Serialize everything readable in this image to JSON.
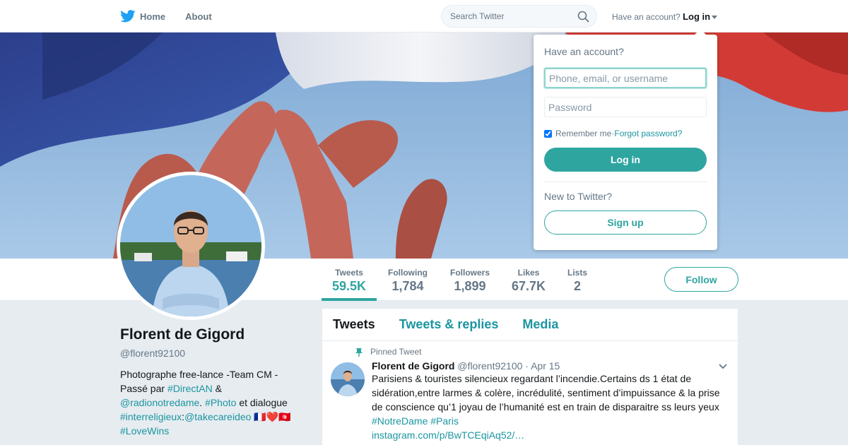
{
  "colors": {
    "accent": "#2fa5a0",
    "link": "#1b95a0",
    "twitter_blue": "#1da1f2"
  },
  "nav": {
    "home_label": "Home",
    "about_label": "About",
    "search_placeholder": "Search Twitter",
    "have_account": "Have an account?",
    "login_label": "Log in"
  },
  "profile": {
    "name": "Florent de Gigord",
    "screen_name": "@florent92100",
    "bio": {
      "t1": "Photographe free-lance -Team CM - Passé par ",
      "link_directan": "#DirectAN",
      "t2": " & ",
      "link_radio": "@radionotredame",
      "t3": ". ",
      "link_photo": "#Photo",
      "t4": " et dialogue ",
      "link_inter": "#interreligieux",
      "t5": ":",
      "link_take": "@takecareideo",
      "t6": " 🇫🇷❤️🇹🇳 ",
      "link_love": "#LoveWins"
    }
  },
  "stats": [
    {
      "label": "Tweets",
      "value": "59.5K"
    },
    {
      "label": "Following",
      "value": "1,784"
    },
    {
      "label": "Followers",
      "value": "1,899"
    },
    {
      "label": "Likes",
      "value": "67.7K"
    },
    {
      "label": "Lists",
      "value": "2"
    }
  ],
  "follow_label": "Follow",
  "timeline": {
    "tabs": [
      "Tweets",
      "Tweets & replies",
      "Media"
    ],
    "tweet": {
      "pinned_label": "Pinned Tweet",
      "name": "Florent de Gigord",
      "screen_name": "@florent92100",
      "time": "· Apr 15",
      "text": "Parisiens & touristes silencieux regardant l’incendie.Certains ds 1 état de sidération,entre larmes & colère, incrédulité, sentiment d’impuissance & la prise de conscience qu’1 joyau de l’humanité est en train de disparaitre ss leurs yeux ",
      "hashtag1": "#NotreDame",
      "hashtag2": "#Paris",
      "link": "instagram.com/p/BwTCEqiAq52/…"
    }
  },
  "login_dropdown": {
    "title": "Have an account?",
    "username_placeholder": "Phone, email, or username",
    "password_placeholder": "Password",
    "remember_label": "Remember me",
    "separator": " · ",
    "forgot_label": "Forgot password?",
    "login_button": "Log in",
    "new_label": "New to Twitter?",
    "signup_button": "Sign up"
  }
}
